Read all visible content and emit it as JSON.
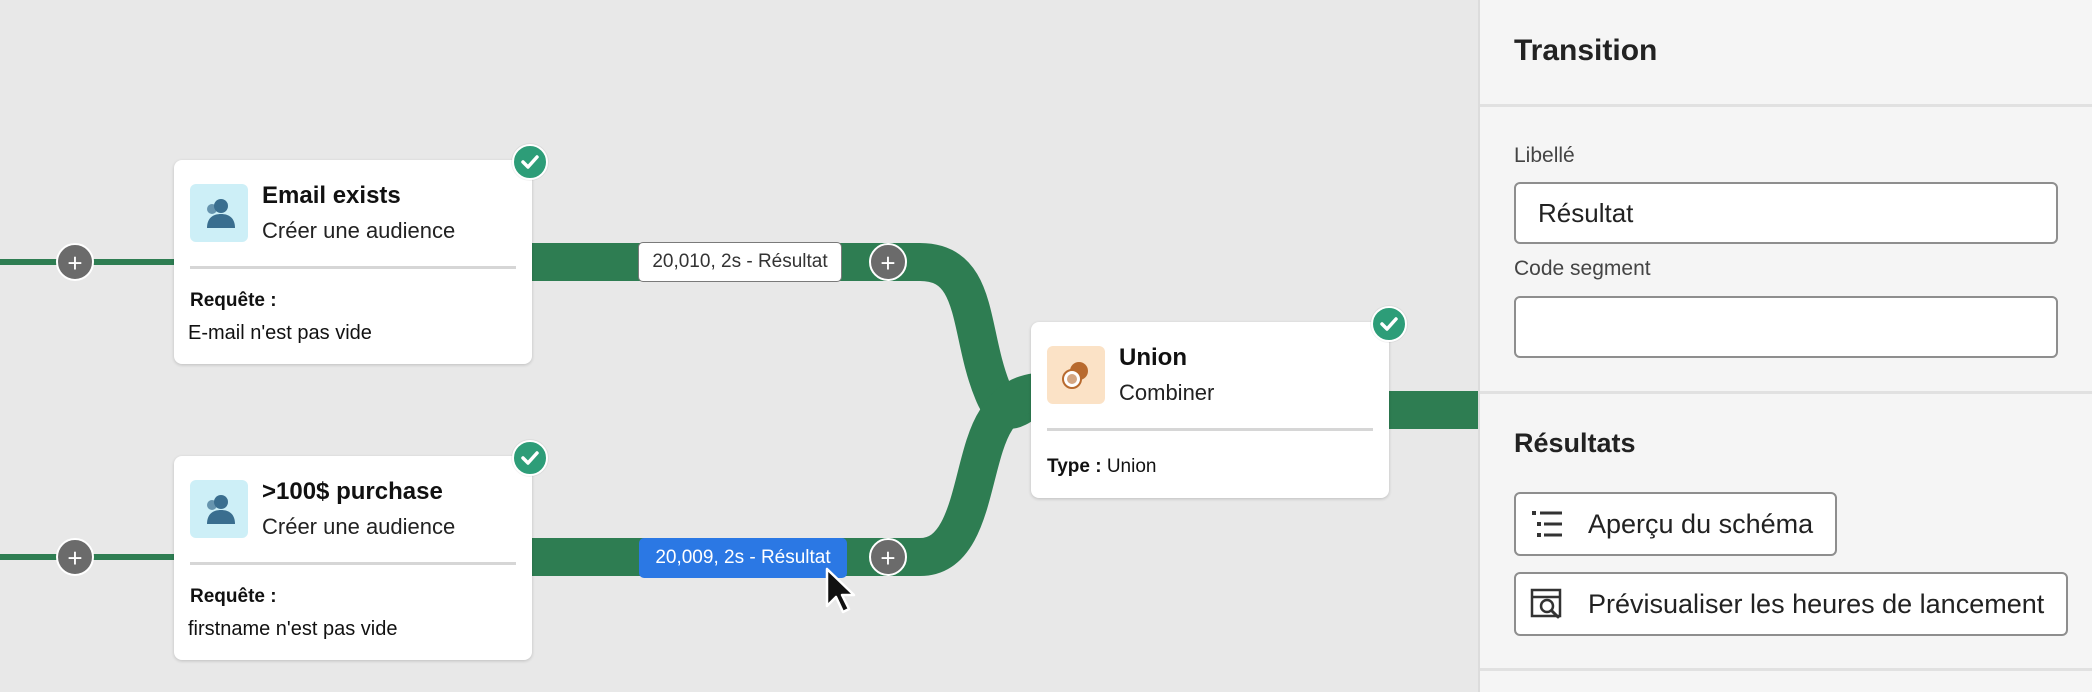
{
  "canvas": {
    "flow_color": "#2e7d52",
    "nodes": {
      "email": {
        "icon": "audience-icon",
        "title": "Email exists",
        "subtitle": "Créer une audience",
        "query_label": "Requête :",
        "query_value": "E-mail n'est pas vide",
        "status": "success-check-icon"
      },
      "purchase": {
        "icon": "audience-icon",
        "title": ">100$ purchase",
        "subtitle": "Créer une audience",
        "query_label": "Requête :",
        "query_value": "firstname n'est pas vide",
        "status": "success-check-icon"
      },
      "union": {
        "icon": "union-icon",
        "title": "Union",
        "subtitle": "Combiner",
        "type_label": "Type :",
        "type_value": "Union",
        "status": "success-check-icon"
      }
    },
    "transitions": {
      "top": "20,010, 2s - Résultat",
      "bottom": "20,009, 2s - Résultat"
    },
    "plus_symbol": "+",
    "selected_color": "#2b78e4"
  },
  "panel": {
    "title": "Transition",
    "label_field": {
      "label": "Libellé",
      "value": "Résultat"
    },
    "segment_field": {
      "label": "Code segment",
      "value": ""
    },
    "results_title": "Résultats",
    "buttons": {
      "schema": {
        "label": "Aperçu du schéma",
        "icon": "list-icon"
      },
      "preview": {
        "label": "Prévisualiser les heures de lancement",
        "icon": "calendar-search-icon"
      }
    }
  }
}
